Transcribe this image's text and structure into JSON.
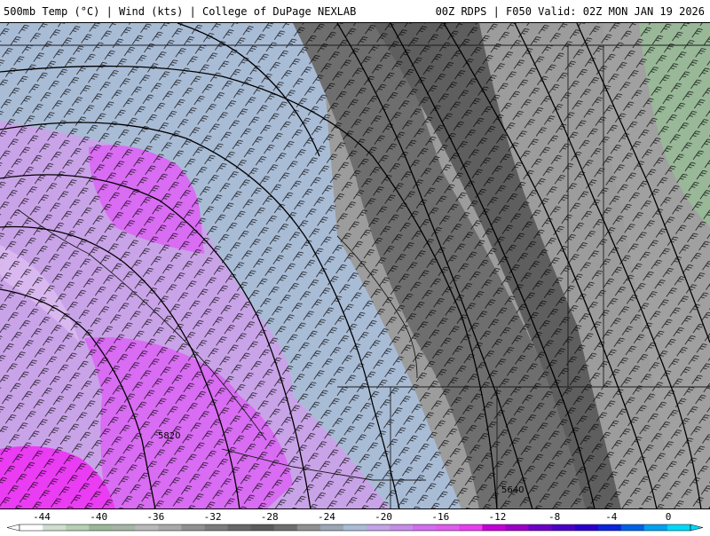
{
  "header": {
    "title_left": "500mb Temp (°C) | Wind (kts) | College of DuPage NEXLAB",
    "title_right": "00Z RDPS | F050 Valid: 02Z MON JAN 19 2026"
  },
  "map": {
    "contour_labels": [
      "5820",
      "5640"
    ]
  },
  "colorbar": {
    "tick_labels": [
      "-44",
      "-40",
      "-36",
      "-32",
      "-28",
      "-24",
      "-20",
      "-16",
      "-12",
      "-8",
      "-4",
      "0"
    ],
    "colors": [
      "#ffffff",
      "#cfdfcf",
      "#b4cfb4",
      "#98b898",
      "#a6b4a6",
      "#b8b8b8",
      "#a8a8a8",
      "#909090",
      "#7c7c7c",
      "#686868",
      "#5c5c5c",
      "#6e6e6e",
      "#8f8f8f",
      "#9aa6b4",
      "#a9bcd6",
      "#c2a3e8",
      "#c78be8",
      "#d36cf0",
      "#e05cf0",
      "#ea3cf2",
      "#c400d8",
      "#9c00c8",
      "#6c00c8",
      "#4a00c8",
      "#2a00d0",
      "#0a24e0",
      "#0060e8",
      "#00a0f0",
      "#00d8f8"
    ]
  }
}
